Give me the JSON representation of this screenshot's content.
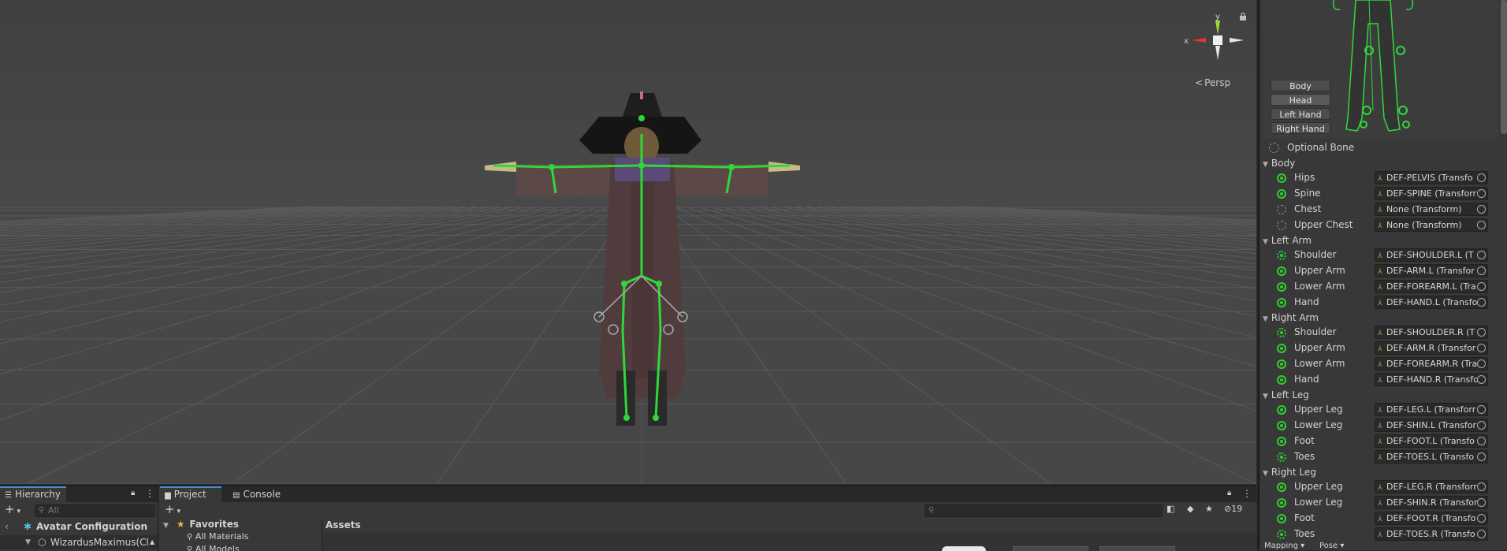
{
  "scene": {
    "gizmo": {
      "y_label": "y",
      "x_label": "x"
    },
    "projection_label": "Persp",
    "lock_icon": "lock-icon",
    "colors": {
      "y_axis": "#9ddc3a",
      "x_axis": "#e0392f",
      "bone": "#2fd83a",
      "background": "#3f3f3f"
    }
  },
  "inspector": {
    "body_parts": [
      "Body",
      "Head",
      "Left Hand",
      "Right Hand"
    ],
    "optional_bone_label": "Optional Bone",
    "groups": [
      {
        "name": "Body",
        "bones": [
          {
            "name": "Hips",
            "value": "DEF-PELVIS (Transfo",
            "state": "mapped"
          },
          {
            "name": "Spine",
            "value": "DEF-SPINE (Transforr",
            "state": "mapped"
          },
          {
            "name": "Chest",
            "value": "None (Transform)",
            "state": "empty"
          },
          {
            "name": "Upper Chest",
            "value": "None (Transform)",
            "state": "empty"
          }
        ]
      },
      {
        "name": "Left Arm",
        "bones": [
          {
            "name": "Shoulder",
            "value": "DEF-SHOULDER.L (T",
            "state": "optional"
          },
          {
            "name": "Upper Arm",
            "value": "DEF-ARM.L (Transfor",
            "state": "mapped"
          },
          {
            "name": "Lower Arm",
            "value": "DEF-FOREARM.L (Tra",
            "state": "mapped"
          },
          {
            "name": "Hand",
            "value": "DEF-HAND.L (Transfo",
            "state": "mapped"
          }
        ]
      },
      {
        "name": "Right Arm",
        "bones": [
          {
            "name": "Shoulder",
            "value": "DEF-SHOULDER.R (T",
            "state": "optional"
          },
          {
            "name": "Upper Arm",
            "value": "DEF-ARM.R (Transfor",
            "state": "mapped"
          },
          {
            "name": "Lower Arm",
            "value": "DEF-FOREARM.R (Tra",
            "state": "mapped"
          },
          {
            "name": "Hand",
            "value": "DEF-HAND.R (Transfo",
            "state": "mapped"
          }
        ]
      },
      {
        "name": "Left Leg",
        "bones": [
          {
            "name": "Upper Leg",
            "value": "DEF-LEG.L (Transforr",
            "state": "mapped"
          },
          {
            "name": "Lower Leg",
            "value": "DEF-SHIN.L (Transfor",
            "state": "mapped"
          },
          {
            "name": "Foot",
            "value": "DEF-FOOT.L (Transfo",
            "state": "mapped"
          },
          {
            "name": "Toes",
            "value": "DEF-TOES.L (Transfo",
            "state": "optional"
          }
        ]
      },
      {
        "name": "Right Leg",
        "bones": [
          {
            "name": "Upper Leg",
            "value": "DEF-LEG.R (Transforr",
            "state": "mapped"
          },
          {
            "name": "Lower Leg",
            "value": "DEF-SHIN.R (Transfor",
            "state": "mapped"
          },
          {
            "name": "Foot",
            "value": "DEF-FOOT.R (Transfo",
            "state": "mapped"
          },
          {
            "name": "Toes",
            "value": "DEF-TOES.R (Transfo",
            "state": "optional"
          }
        ]
      }
    ],
    "footer": {
      "mapping": "Mapping",
      "pose": "Pose"
    }
  },
  "hierarchy": {
    "tab_label": "Hierarchy",
    "search_placeholder": "All",
    "items": [
      {
        "label": "Avatar Configuration"
      },
      {
        "label": "WizardusMaximus(Clc"
      }
    ]
  },
  "project": {
    "tabs": [
      "Project",
      "Console"
    ],
    "favorites_label": "Favorites",
    "favorites": [
      "All Materials",
      "All Models"
    ],
    "assets_label": "Assets",
    "hidden_count": "19"
  }
}
